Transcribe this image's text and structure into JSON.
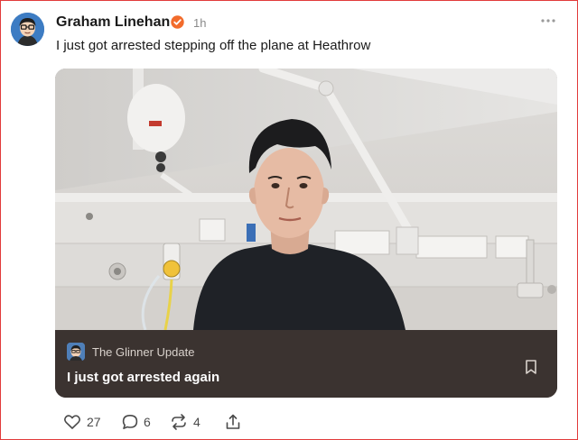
{
  "post": {
    "author": "Graham Linehan",
    "time": "1h",
    "text": "I just got arrested stepping off the plane at Heathrow"
  },
  "card": {
    "publication": "The Glinner Update",
    "headline": "I just got arrested again"
  },
  "actions": {
    "likes": "27",
    "comments": "6",
    "restacks": "4"
  },
  "icons": {
    "verified": "verified-badge-icon",
    "more": "more-options-icon",
    "bookmark": "bookmark-icon",
    "like": "heart-icon",
    "comment": "comment-icon",
    "restack": "restack-icon",
    "share": "share-icon"
  },
  "colors": {
    "verified_badge": "#f26b2b",
    "caption_bg": "#3b3330",
    "frame_border": "#e23b3b"
  }
}
